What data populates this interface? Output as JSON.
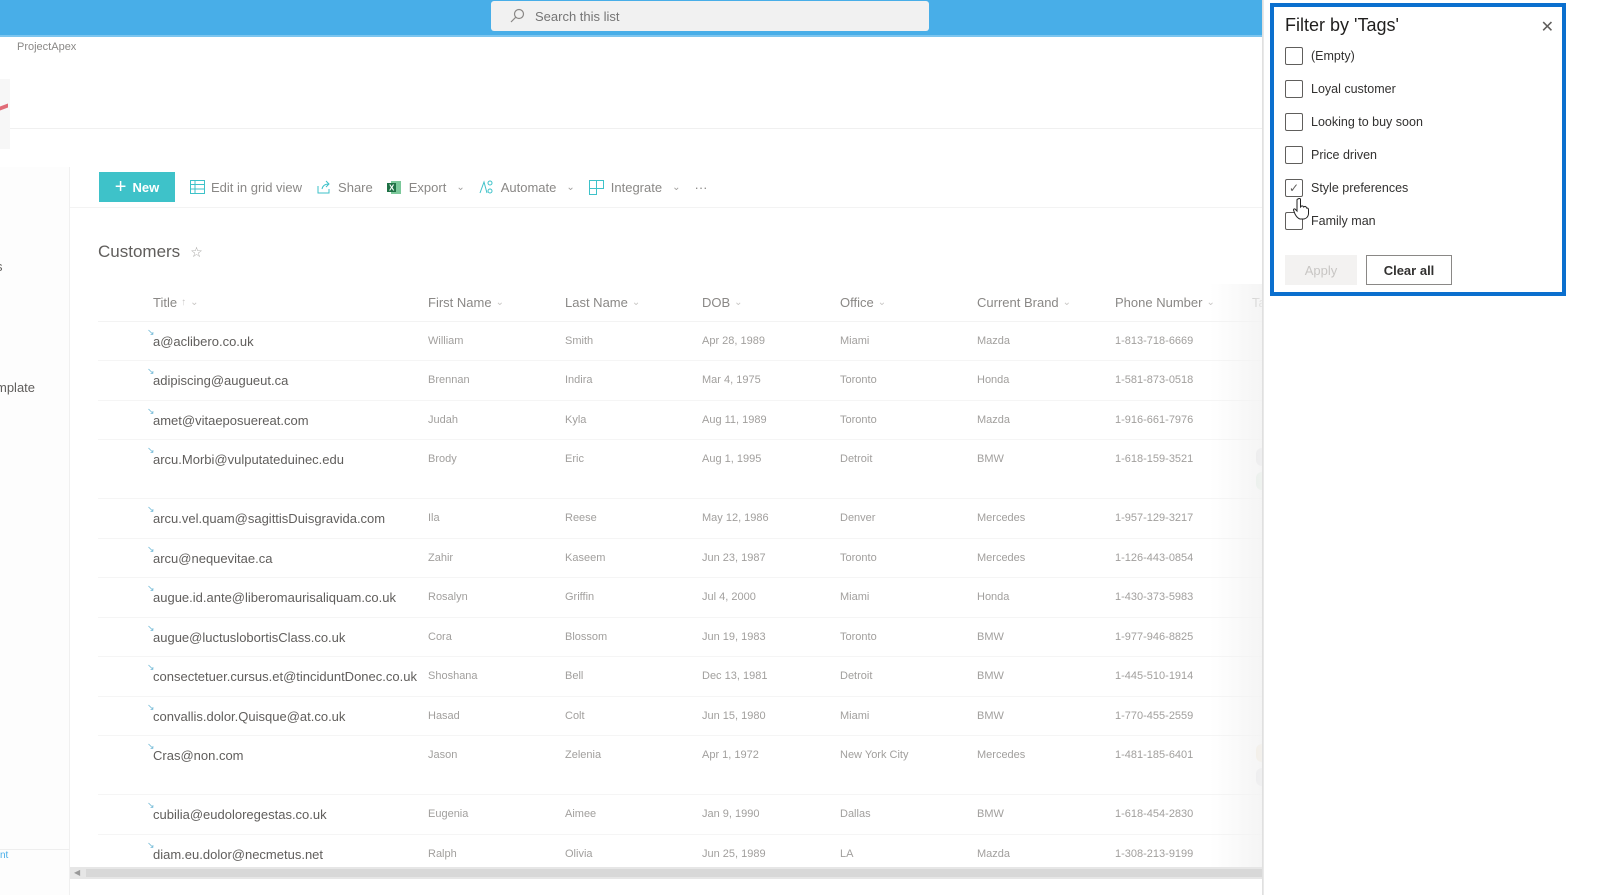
{
  "search": {
    "placeholder": "Search this list"
  },
  "site": {
    "name": "ProjectApex"
  },
  "leftnav": {
    "items": [
      "s",
      "mplate"
    ],
    "footer": "nt"
  },
  "commandbar": {
    "new_label": "New",
    "edit_grid_label": "Edit in grid view",
    "share_label": "Share",
    "export_label": "Export",
    "automate_label": "Automate",
    "integrate_label": "Integrate",
    "more_label": "···"
  },
  "list": {
    "title": "Customers"
  },
  "columns": {
    "title": "Title",
    "title_sort": "↑",
    "first_name": "First Name",
    "last_name": "Last Name",
    "dob": "DOB",
    "office": "Office",
    "current_brand": "Current Brand",
    "phone": "Phone Number",
    "tags": "Ta"
  },
  "rows": [
    {
      "title": "a@aclibero.co.uk",
      "first": "William",
      "last": "Smith",
      "dob": "Apr 28, 1989",
      "office": "Miami",
      "brand": "Mazda",
      "phone": "1-813-718-6669"
    },
    {
      "title": "adipiscing@augueut.ca",
      "first": "Brennan",
      "last": "Indira",
      "dob": "Mar 4, 1975",
      "office": "Toronto",
      "brand": "Honda",
      "phone": "1-581-873-0518"
    },
    {
      "title": "amet@vitaeposuereat.com",
      "first": "Judah",
      "last": "Kyla",
      "dob": "Aug 11, 1989",
      "office": "Toronto",
      "brand": "Mazda",
      "phone": "1-916-661-7976"
    },
    {
      "title": "arcu.Morbi@vulputateduinec.edu",
      "first": "Brody",
      "last": "Eric",
      "dob": "Aug 1, 1995",
      "office": "Detroit",
      "brand": "BMW",
      "phone": "1-618-159-3521"
    },
    {
      "title": "arcu.vel.quam@sagittisDuisgravida.com",
      "first": "Ila",
      "last": "Reese",
      "dob": "May 12, 1986",
      "office": "Denver",
      "brand": "Mercedes",
      "phone": "1-957-129-3217"
    },
    {
      "title": "arcu@nequevitae.ca",
      "first": "Zahir",
      "last": "Kaseem",
      "dob": "Jun 23, 1987",
      "office": "Toronto",
      "brand": "Mercedes",
      "phone": "1-126-443-0854"
    },
    {
      "title": "augue.id.ante@liberomaurisaliquam.co.uk",
      "first": "Rosalyn",
      "last": "Griffin",
      "dob": "Jul 4, 2000",
      "office": "Miami",
      "brand": "Honda",
      "phone": "1-430-373-5983"
    },
    {
      "title": "augue@luctuslobortisClass.co.uk",
      "first": "Cora",
      "last": "Blossom",
      "dob": "Jun 19, 1983",
      "office": "Toronto",
      "brand": "BMW",
      "phone": "1-977-946-8825"
    },
    {
      "title": "consectetuer.cursus.et@tinciduntDonec.co.uk",
      "first": "Shoshana",
      "last": "Bell",
      "dob": "Dec 13, 1981",
      "office": "Detroit",
      "brand": "BMW",
      "phone": "1-445-510-1914"
    },
    {
      "title": "convallis.dolor.Quisque@at.co.uk",
      "first": "Hasad",
      "last": "Colt",
      "dob": "Jun 15, 1980",
      "office": "Miami",
      "brand": "BMW",
      "phone": "1-770-455-2559"
    },
    {
      "title": "Cras@non.com",
      "first": "Jason",
      "last": "Zelenia",
      "dob": "Apr 1, 1972",
      "office": "New York City",
      "brand": "Mercedes",
      "phone": "1-481-185-6401"
    },
    {
      "title": "cubilia@eudoloregestas.co.uk",
      "first": "Eugenia",
      "last": "Aimee",
      "dob": "Jan 9, 1990",
      "office": "Dallas",
      "brand": "BMW",
      "phone": "1-618-454-2830"
    },
    {
      "title": "diam.eu.dolor@necmetus.net",
      "first": "Ralph",
      "last": "Olivia",
      "dob": "Jun 25, 1989",
      "office": "LA",
      "brand": "Mazda",
      "phone": "1-308-213-9199"
    }
  ],
  "filter_panel": {
    "title": "Filter by 'Tags'",
    "options": [
      {
        "label": "(Empty)",
        "checked": false
      },
      {
        "label": "Loyal customer",
        "checked": false
      },
      {
        "label": "Looking to buy soon",
        "checked": false
      },
      {
        "label": "Price driven",
        "checked": false
      },
      {
        "label": "Style preferences",
        "checked": true
      },
      {
        "label": "Family man",
        "checked": false
      }
    ],
    "apply_label": "Apply",
    "clear_label": "Clear all"
  },
  "colors": {
    "topbar": "#48aee8",
    "new_button": "#3ec2c9",
    "panel_border": "#0b6fce"
  }
}
